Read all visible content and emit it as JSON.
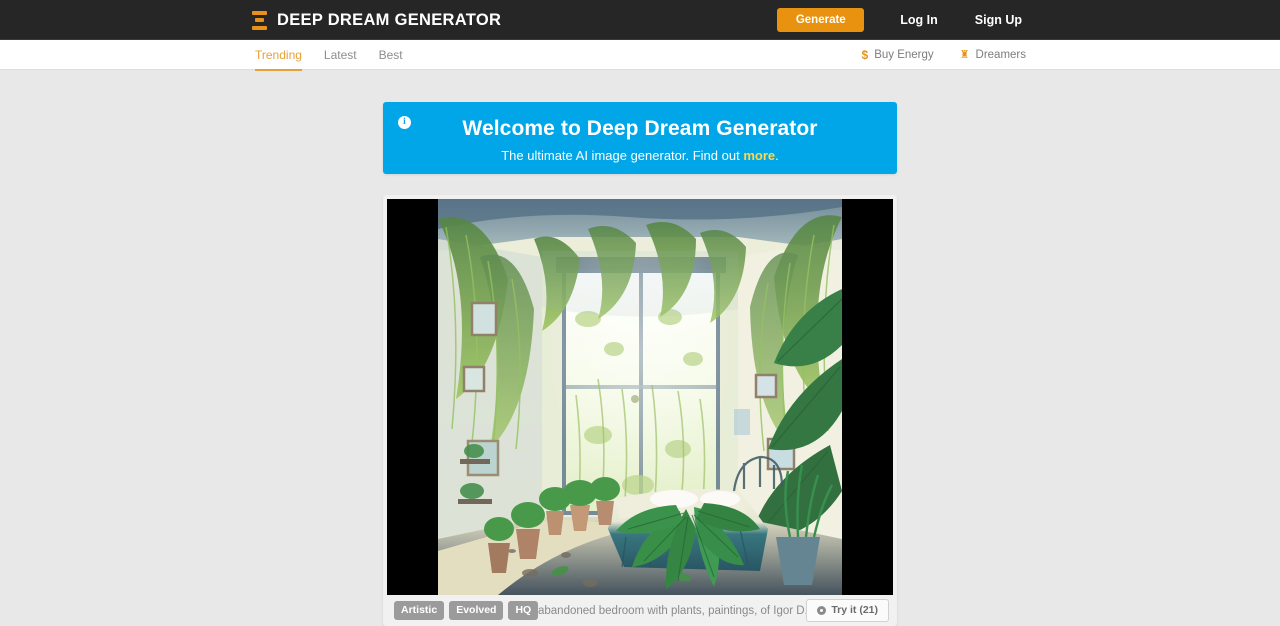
{
  "site": {
    "logo_icon": "hourglass-logo-icon",
    "brand": "DEEP DREAM GENERATOR",
    "accent_color": "#e8921a",
    "header_bg": "#262626",
    "page_bg": "#e8e8e8"
  },
  "header": {
    "generate_label": "Generate",
    "login_label": "Log In",
    "signup_label": "Sign Up"
  },
  "subnav": {
    "tabs": [
      {
        "label": "Trending",
        "active": true
      },
      {
        "label": "Latest",
        "active": false
      },
      {
        "label": "Best",
        "active": false
      }
    ],
    "actions": [
      {
        "icon": "dollar-icon",
        "glyph": "$",
        "label": "Buy Energy"
      },
      {
        "icon": "trophy-icon",
        "glyph": "♜",
        "label": "Dreamers"
      }
    ]
  },
  "banner": {
    "icon": "info-icon",
    "icon_glyph": "i",
    "title": "Welcome to Deep Dream Generator",
    "subtitle_before": "The ultimate AI image generator. Find out ",
    "subtitle_link": "more",
    "subtitle_after": ".",
    "bg_color": "#00a6e8",
    "link_color": "#ffd84d"
  },
  "card": {
    "image_alt": "abandoned bedroom overgrown with plants, watercolor illustration",
    "tags": [
      "Artistic",
      "Evolved",
      "HQ"
    ],
    "description": "abandoned bedroom with plants, paintings, of Igor D...",
    "try_icon": "target-icon",
    "try_label": "Try it (21)"
  }
}
